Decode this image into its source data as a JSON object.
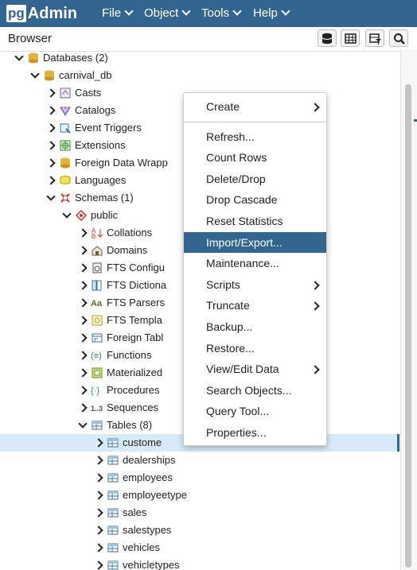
{
  "app": {
    "logo_pg": "pg",
    "logo_admin": "Admin"
  },
  "menu": [
    "File",
    "Object",
    "Tools",
    "Help"
  ],
  "browser": {
    "title": "Browser"
  },
  "tree": [
    {
      "label": "Databases (2)",
      "icon": "databases-icon"
    },
    {
      "label": "carnival_db",
      "icon": "database-icon"
    },
    {
      "label": "Casts",
      "icon": "casts-icon"
    },
    {
      "label": "Catalogs",
      "icon": "catalogs-icon"
    },
    {
      "label": "Event Triggers",
      "icon": "event-triggers-icon"
    },
    {
      "label": "Extensions",
      "icon": "extensions-icon"
    },
    {
      "label": "Foreign Data Wrapp",
      "icon": "foreign-data-wrapper-icon"
    },
    {
      "label": "Languages",
      "icon": "languages-icon"
    },
    {
      "label": "Schemas (1)",
      "icon": "schemas-icon"
    },
    {
      "label": "public",
      "icon": "schema-icon"
    },
    {
      "label": "Collations",
      "icon": "collations-icon"
    },
    {
      "label": "Domains",
      "icon": "domains-icon"
    },
    {
      "label": "FTS Configu",
      "icon": "fts-configuration-icon"
    },
    {
      "label": "FTS Dictiona",
      "icon": "fts-dictionary-icon"
    },
    {
      "label": "FTS Parsers",
      "icon": "fts-parser-icon"
    },
    {
      "label": "FTS Templa",
      "icon": "fts-template-icon"
    },
    {
      "label": "Foreign Tabl",
      "icon": "foreign-table-icon"
    },
    {
      "label": "Functions",
      "icon": "functions-icon"
    },
    {
      "label": "Materialized",
      "icon": "materialized-view-icon"
    },
    {
      "label": "Procedures",
      "icon": "procedures-icon"
    },
    {
      "label": "Sequences",
      "icon": "sequences-icon"
    },
    {
      "label": "Tables (8)",
      "icon": "tables-icon"
    },
    {
      "label": "custome",
      "icon": "table-icon"
    },
    {
      "label": "dealerships",
      "icon": "table-icon"
    },
    {
      "label": "employees",
      "icon": "table-icon"
    },
    {
      "label": "employeetype",
      "icon": "table-icon"
    },
    {
      "label": "sales",
      "icon": "table-icon"
    },
    {
      "label": "salestypes",
      "icon": "table-icon"
    },
    {
      "label": "vehicles",
      "icon": "table-icon"
    },
    {
      "label": "vehicletypes",
      "icon": "table-icon"
    }
  ],
  "context_menu": [
    {
      "label": "Create",
      "submenu": true
    },
    {
      "label": "Refresh..."
    },
    {
      "label": "Count Rows"
    },
    {
      "label": "Delete/Drop"
    },
    {
      "label": "Drop Cascade"
    },
    {
      "label": "Reset Statistics"
    },
    {
      "label": "Import/Export...",
      "highlighted": true
    },
    {
      "label": "Maintenance..."
    },
    {
      "label": "Scripts",
      "submenu": true
    },
    {
      "label": "Truncate",
      "submenu": true
    },
    {
      "label": "Backup..."
    },
    {
      "label": "Restore..."
    },
    {
      "label": "View/Edit Data",
      "submenu": true
    },
    {
      "label": "Search Objects..."
    },
    {
      "label": "Query Tool..."
    },
    {
      "label": "Properties..."
    }
  ],
  "sequences_icon_text": "1..3",
  "fts_parser_icon_text": "Aa",
  "collation_icon_text": "A"
}
